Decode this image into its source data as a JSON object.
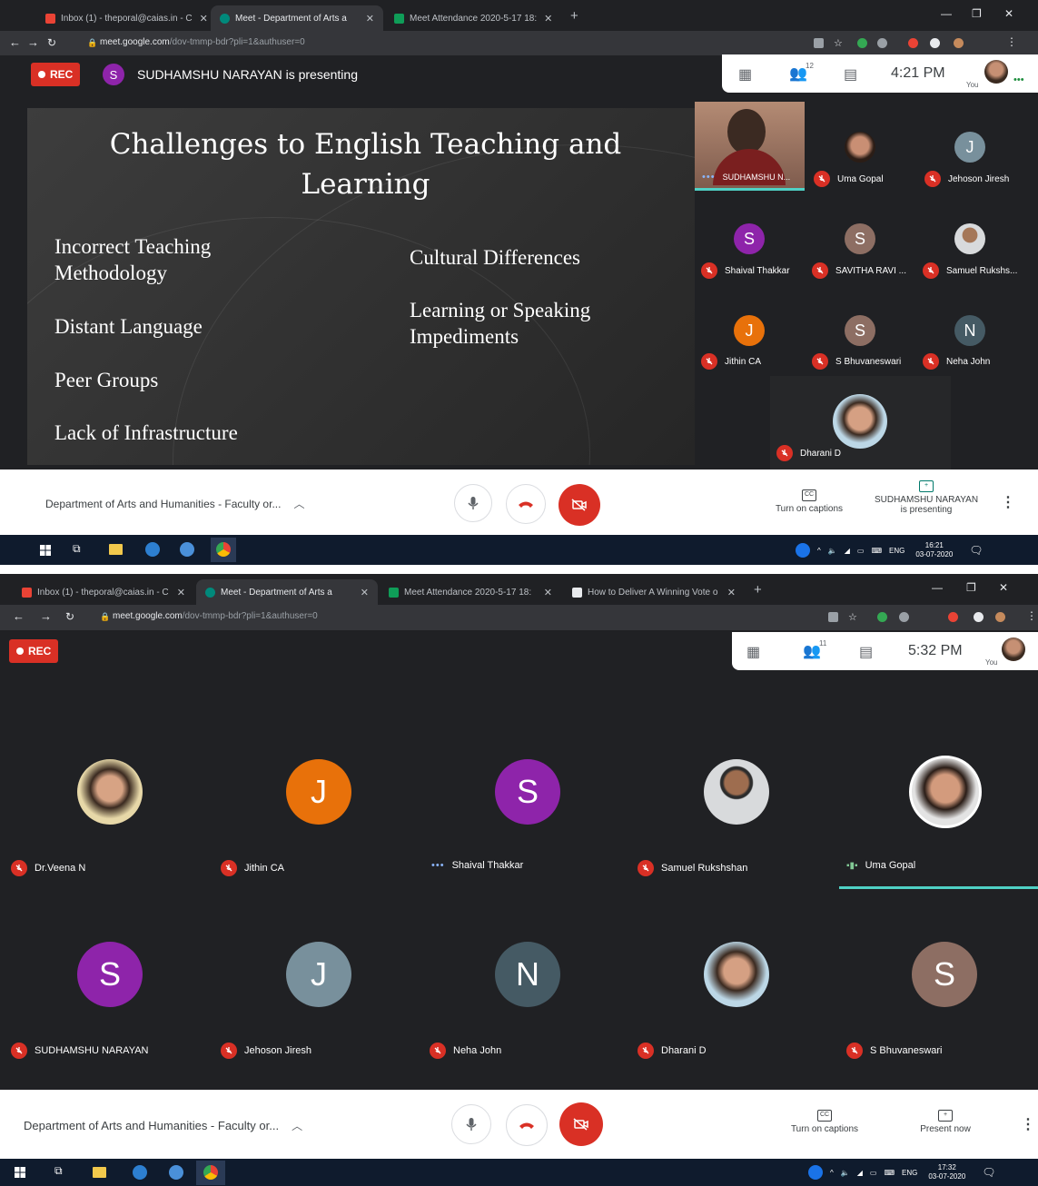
{
  "colors": {
    "meet_bg": "#202124",
    "rec_red": "#d93025",
    "active_speaker": "#4fd1c5",
    "avatar_purple": "#8e24aa",
    "avatar_orange": "#e8710a",
    "avatar_brown": "#8d6e63",
    "avatar_slate": "#455a64",
    "avatar_bluegray": "#78909c",
    "taskbar": "#0f1b2d"
  },
  "screenshot1": {
    "tabs": [
      {
        "label": "Inbox (1) - theporal@caias.in - C",
        "icon": "gmail-icon"
      },
      {
        "label": "Meet - Department of Arts a",
        "icon": "meet-icon"
      },
      {
        "label": "Meet Attendance 2020-5-17 18:",
        "icon": "sheets-icon"
      }
    ],
    "url_host": "meet.google.com",
    "url_path": "/dov-tmmp-bdr?pli=1&authuser=0",
    "rec_label": "REC",
    "presenter_initial": "S",
    "presenter_text": "SUDHAMSHU NARAYAN is presenting",
    "participant_count": "12",
    "time": "4:21 PM",
    "you_label": "You",
    "slide": {
      "title_line1": "Challenges to English Teaching and",
      "title_line2": "Learning",
      "left_items": [
        "Incorrect Teaching",
        "Methodology",
        "Distant Language",
        "Peer Groups",
        "Lack of Infrastructure"
      ],
      "right_items": [
        "Cultural Differences",
        "Learning or Speaking",
        "Impediments"
      ]
    },
    "tiles": [
      {
        "name": "SUDHAMSHU N...",
        "type": "video"
      },
      {
        "name": "Uma Gopal",
        "type": "photo"
      },
      {
        "name": "Jehoson Jiresh",
        "initial": "J",
        "color": "#78909c"
      },
      {
        "name": "Shaival Thakkar",
        "initial": "S",
        "color": "#8e24aa"
      },
      {
        "name": "SAVITHA RAVI ...",
        "initial": "S",
        "color": "#8d6e63"
      },
      {
        "name": "Samuel Rukshs...",
        "type": "photo"
      },
      {
        "name": "Jithin CA",
        "initial": "J",
        "color": "#e8710a"
      },
      {
        "name": "S Bhuvaneswari",
        "initial": "S",
        "color": "#8d6e63"
      },
      {
        "name": "Neha John",
        "initial": "N",
        "color": "#455a64"
      },
      {
        "name": "Dharani D",
        "type": "photo"
      }
    ],
    "meeting_title": "Department of Arts and Humanities - Faculty or...",
    "captions_label": "Turn on captions",
    "present_label_1": "SUDHAMSHU NARAYAN",
    "present_label_2": "is presenting",
    "tray_lang": "ENG",
    "tray_time": "16:21",
    "tray_date": "03-07-2020"
  },
  "screenshot2": {
    "tabs": [
      {
        "label": "Inbox (1) - theporal@caias.in - C",
        "icon": "gmail-icon"
      },
      {
        "label": "Meet - Department of Arts a",
        "icon": "meet-icon"
      },
      {
        "label": "Meet Attendance 2020-5-17 18:",
        "icon": "sheets-icon"
      },
      {
        "label": "How to Deliver A Winning Vote o",
        "icon": "doc-icon"
      }
    ],
    "url_host": "meet.google.com",
    "url_path": "/dov-tmmp-bdr?pli=1&authuser=0",
    "rec_label": "REC",
    "participant_count": "11",
    "time": "5:32 PM",
    "you_label": "You",
    "row1": [
      {
        "name": "Dr.Veena N",
        "type": "photo",
        "status": "muted"
      },
      {
        "name": "Jithin CA",
        "initial": "J",
        "color": "#e8710a",
        "status": "muted"
      },
      {
        "name": "Shaival Thakkar",
        "initial": "S",
        "color": "#8e24aa",
        "status": "dots"
      },
      {
        "name": "Samuel Rukshshan",
        "type": "photo",
        "status": "muted"
      },
      {
        "name": "Uma Gopal",
        "type": "photo",
        "status": "speaking"
      }
    ],
    "row2": [
      {
        "name": "SUDHAMSHU NARAYAN",
        "initial": "S",
        "color": "#8e24aa",
        "status": "muted"
      },
      {
        "name": "Jehoson Jiresh",
        "initial": "J",
        "color": "#78909c",
        "status": "muted"
      },
      {
        "name": "Neha John",
        "initial": "N",
        "color": "#455a64",
        "status": "muted"
      },
      {
        "name": "Dharani D",
        "type": "photo",
        "status": "muted"
      },
      {
        "name": "S Bhuvaneswari",
        "initial": "S",
        "color": "#8d6e63",
        "status": "muted"
      }
    ],
    "meeting_title": "Department of Arts and Humanities - Faculty or...",
    "captions_label": "Turn on captions",
    "present_label": "Present now",
    "tray_lang": "ENG",
    "tray_time": "17:32",
    "tray_date": "03-07-2020"
  }
}
